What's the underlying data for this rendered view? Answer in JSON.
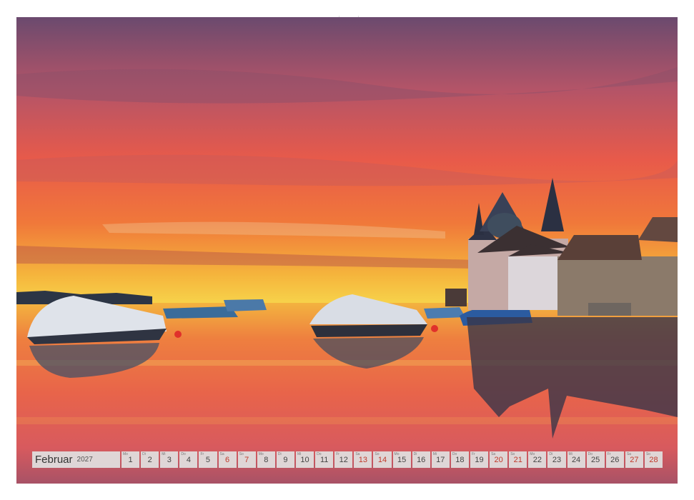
{
  "calendar": {
    "month": "Februar",
    "year": "2027",
    "days": [
      {
        "weekday": "Mo",
        "day": "1",
        "weekend": false
      },
      {
        "weekday": "Di",
        "day": "2",
        "weekend": false
      },
      {
        "weekday": "Mi",
        "day": "3",
        "weekend": false
      },
      {
        "weekday": "Do",
        "day": "4",
        "weekend": false
      },
      {
        "weekday": "Fr",
        "day": "5",
        "weekend": false
      },
      {
        "weekday": "Sa",
        "day": "6",
        "weekend": true
      },
      {
        "weekday": "So",
        "day": "7",
        "weekend": true
      },
      {
        "weekday": "Mo",
        "day": "8",
        "weekend": false
      },
      {
        "weekday": "Di",
        "day": "9",
        "weekend": false
      },
      {
        "weekday": "Mi",
        "day": "10",
        "weekend": false
      },
      {
        "weekday": "Do",
        "day": "11",
        "weekend": false
      },
      {
        "weekday": "Fr",
        "day": "12",
        "weekend": false
      },
      {
        "weekday": "Sa",
        "day": "13",
        "weekend": true
      },
      {
        "weekday": "So",
        "day": "14",
        "weekend": true
      },
      {
        "weekday": "Mo",
        "day": "15",
        "weekend": false
      },
      {
        "weekday": "Di",
        "day": "16",
        "weekend": false
      },
      {
        "weekday": "Mi",
        "day": "17",
        "weekend": false
      },
      {
        "weekday": "Do",
        "day": "18",
        "weekend": false
      },
      {
        "weekday": "Fr",
        "day": "19",
        "weekend": false
      },
      {
        "weekday": "Sa",
        "day": "20",
        "weekend": true
      },
      {
        "weekday": "So",
        "day": "21",
        "weekend": true
      },
      {
        "weekday": "Mo",
        "day": "22",
        "weekend": false
      },
      {
        "weekday": "Di",
        "day": "23",
        "weekend": false
      },
      {
        "weekday": "Mi",
        "day": "24",
        "weekend": false
      },
      {
        "weekday": "Do",
        "day": "25",
        "weekend": false
      },
      {
        "weekday": "Fr",
        "day": "26",
        "weekend": false
      },
      {
        "weekday": "Sa",
        "day": "27",
        "weekend": true
      },
      {
        "weekday": "So",
        "day": "28",
        "weekend": true
      }
    ]
  },
  "colors": {
    "weekend": "#c0392b",
    "sky_top": "#6b4a6e",
    "sky_horizon": "#f7c443",
    "water": "#e8644a"
  }
}
